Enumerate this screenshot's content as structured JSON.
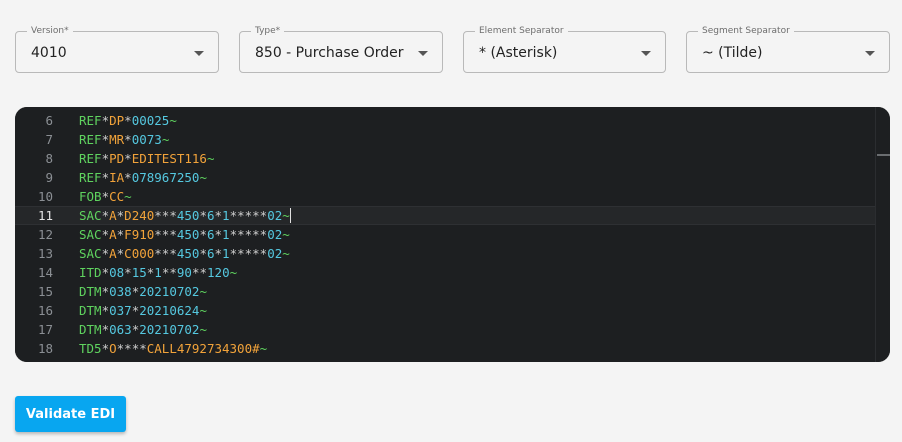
{
  "fields": {
    "version": {
      "label": "Version*",
      "value": "4010"
    },
    "type": {
      "label": "Type*",
      "value": "850 - Purchase Order"
    },
    "element_separator": {
      "label": "Element Separator",
      "value": "* (Asterisk)"
    },
    "segment_separator": {
      "label": "Segment Separator",
      "value": "~ (Tilde)"
    }
  },
  "editor": {
    "active_line": 11,
    "lines": [
      {
        "n": "6",
        "tokens": [
          {
            "t": "REF",
            "c": "seg"
          },
          {
            "t": "*",
            "c": "sep"
          },
          {
            "t": "DP",
            "c": "el"
          },
          {
            "t": "*",
            "c": "sep"
          },
          {
            "t": "00025",
            "c": "num"
          },
          {
            "t": "~",
            "c": "term"
          }
        ]
      },
      {
        "n": "7",
        "tokens": [
          {
            "t": "REF",
            "c": "seg"
          },
          {
            "t": "*",
            "c": "sep"
          },
          {
            "t": "MR",
            "c": "el"
          },
          {
            "t": "*",
            "c": "sep"
          },
          {
            "t": "0073",
            "c": "num"
          },
          {
            "t": "~",
            "c": "term"
          }
        ]
      },
      {
        "n": "8",
        "tokens": [
          {
            "t": "REF",
            "c": "seg"
          },
          {
            "t": "*",
            "c": "sep"
          },
          {
            "t": "PD",
            "c": "el"
          },
          {
            "t": "*",
            "c": "sep"
          },
          {
            "t": "EDITEST116",
            "c": "el"
          },
          {
            "t": "~",
            "c": "term"
          }
        ]
      },
      {
        "n": "9",
        "tokens": [
          {
            "t": "REF",
            "c": "seg"
          },
          {
            "t": "*",
            "c": "sep"
          },
          {
            "t": "IA",
            "c": "el"
          },
          {
            "t": "*",
            "c": "sep"
          },
          {
            "t": "078967250",
            "c": "num"
          },
          {
            "t": "~",
            "c": "term"
          }
        ]
      },
      {
        "n": "10",
        "tokens": [
          {
            "t": "FOB",
            "c": "seg"
          },
          {
            "t": "*",
            "c": "sep"
          },
          {
            "t": "CC",
            "c": "el"
          },
          {
            "t": "~",
            "c": "term"
          }
        ]
      },
      {
        "n": "11",
        "tokens": [
          {
            "t": "SAC",
            "c": "seg"
          },
          {
            "t": "*",
            "c": "sep"
          },
          {
            "t": "A",
            "c": "el"
          },
          {
            "t": "*",
            "c": "sep"
          },
          {
            "t": "D240",
            "c": "el"
          },
          {
            "t": "***",
            "c": "sep"
          },
          {
            "t": "450",
            "c": "num"
          },
          {
            "t": "*",
            "c": "sep"
          },
          {
            "t": "6",
            "c": "num"
          },
          {
            "t": "*",
            "c": "sep"
          },
          {
            "t": "1",
            "c": "num"
          },
          {
            "t": "*****",
            "c": "sep"
          },
          {
            "t": "02",
            "c": "num"
          },
          {
            "t": "~",
            "c": "term"
          }
        ]
      },
      {
        "n": "12",
        "tokens": [
          {
            "t": "SAC",
            "c": "seg"
          },
          {
            "t": "*",
            "c": "sep"
          },
          {
            "t": "A",
            "c": "el"
          },
          {
            "t": "*",
            "c": "sep"
          },
          {
            "t": "F910",
            "c": "el"
          },
          {
            "t": "***",
            "c": "sep"
          },
          {
            "t": "450",
            "c": "num"
          },
          {
            "t": "*",
            "c": "sep"
          },
          {
            "t": "6",
            "c": "num"
          },
          {
            "t": "*",
            "c": "sep"
          },
          {
            "t": "1",
            "c": "num"
          },
          {
            "t": "*****",
            "c": "sep"
          },
          {
            "t": "02",
            "c": "num"
          },
          {
            "t": "~",
            "c": "term"
          }
        ]
      },
      {
        "n": "13",
        "tokens": [
          {
            "t": "SAC",
            "c": "seg"
          },
          {
            "t": "*",
            "c": "sep"
          },
          {
            "t": "A",
            "c": "el"
          },
          {
            "t": "*",
            "c": "sep"
          },
          {
            "t": "C000",
            "c": "el"
          },
          {
            "t": "***",
            "c": "sep"
          },
          {
            "t": "450",
            "c": "num"
          },
          {
            "t": "*",
            "c": "sep"
          },
          {
            "t": "6",
            "c": "num"
          },
          {
            "t": "*",
            "c": "sep"
          },
          {
            "t": "1",
            "c": "num"
          },
          {
            "t": "*****",
            "c": "sep"
          },
          {
            "t": "02",
            "c": "num"
          },
          {
            "t": "~",
            "c": "term"
          }
        ]
      },
      {
        "n": "14",
        "tokens": [
          {
            "t": "ITD",
            "c": "seg"
          },
          {
            "t": "*",
            "c": "sep"
          },
          {
            "t": "08",
            "c": "num"
          },
          {
            "t": "*",
            "c": "sep"
          },
          {
            "t": "15",
            "c": "num"
          },
          {
            "t": "*",
            "c": "sep"
          },
          {
            "t": "1",
            "c": "num"
          },
          {
            "t": "**",
            "c": "sep"
          },
          {
            "t": "90",
            "c": "num"
          },
          {
            "t": "**",
            "c": "sep"
          },
          {
            "t": "120",
            "c": "num"
          },
          {
            "t": "~",
            "c": "term"
          }
        ]
      },
      {
        "n": "15",
        "tokens": [
          {
            "t": "DTM",
            "c": "seg"
          },
          {
            "t": "*",
            "c": "sep"
          },
          {
            "t": "038",
            "c": "num"
          },
          {
            "t": "*",
            "c": "sep"
          },
          {
            "t": "20210702",
            "c": "num"
          },
          {
            "t": "~",
            "c": "term"
          }
        ]
      },
      {
        "n": "16",
        "tokens": [
          {
            "t": "DTM",
            "c": "seg"
          },
          {
            "t": "*",
            "c": "sep"
          },
          {
            "t": "037",
            "c": "num"
          },
          {
            "t": "*",
            "c": "sep"
          },
          {
            "t": "20210624",
            "c": "num"
          },
          {
            "t": "~",
            "c": "term"
          }
        ]
      },
      {
        "n": "17",
        "tokens": [
          {
            "t": "DTM",
            "c": "seg"
          },
          {
            "t": "*",
            "c": "sep"
          },
          {
            "t": "063",
            "c": "num"
          },
          {
            "t": "*",
            "c": "sep"
          },
          {
            "t": "20210702",
            "c": "num"
          },
          {
            "t": "~",
            "c": "term"
          }
        ]
      },
      {
        "n": "18",
        "tokens": [
          {
            "t": "TD5",
            "c": "seg"
          },
          {
            "t": "*",
            "c": "sep"
          },
          {
            "t": "O",
            "c": "el"
          },
          {
            "t": "****",
            "c": "sep"
          },
          {
            "t": "CALL4792734300#",
            "c": "el"
          },
          {
            "t": "~",
            "c": "term"
          }
        ]
      }
    ],
    "upload_icon": "file-upload-icon",
    "save_icon": "floppy-save-icon"
  },
  "validate_button": {
    "label": "Validate EDI"
  },
  "colors": {
    "accent": "#08a6f0",
    "editor_bg": "#1d1f21",
    "segment": "#5fd35f",
    "element": "#f2a33a",
    "number": "#55c8e0"
  }
}
